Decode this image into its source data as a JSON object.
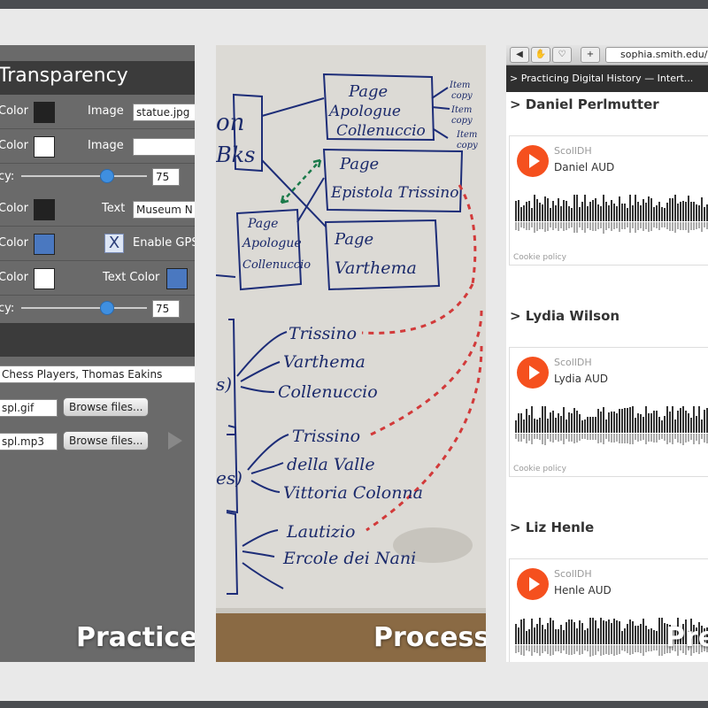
{
  "panel_practice": {
    "title": "Transparency",
    "rows": [
      {
        "label": "Color",
        "right_label": "Image",
        "value": "statue.jpg",
        "swatch": "#222222"
      },
      {
        "label": "Color",
        "right_label": "Image",
        "value": "",
        "swatch": "#ffffff"
      },
      {
        "label": "Color",
        "right_label": "Text",
        "value": "Museum N",
        "swatch": "#222222"
      },
      {
        "label": "Color",
        "right_label": "Enable GPS",
        "swatch": "#4a78c0",
        "checked": "X"
      },
      {
        "label": "Color",
        "right_label": "Text Color",
        "swatch": "#ffffff",
        "swatch2": "#4a78c0"
      }
    ],
    "opacity_label": "cy:",
    "opacity_value_1": "75",
    "opacity_value_2": "75",
    "caption_field": "Chess Players, Thomas Eakins",
    "file1": "spl.gif",
    "file2": "spl.mp3",
    "browse_label": "Browse files...",
    "caption": "Practice"
  },
  "panel_process": {
    "caption": "Process",
    "boxes": [
      "Page",
      "Apologue",
      "Collenuccio",
      "Page",
      "Epistola Trissino",
      "Page",
      "Apologue",
      "Collenuccio",
      "Page",
      "Varthema"
    ],
    "item_notes": [
      "Item",
      "copy",
      "Item",
      "copy",
      "Item",
      "copy"
    ],
    "left_words": [
      "on",
      "Bks"
    ],
    "branches_1": [
      "Trissino",
      "Varthema",
      "Collenuccio"
    ],
    "branches_2": [
      "Trissino",
      "della Valle",
      "Vittoria Colonna"
    ],
    "branches_3": [
      "Lautizio",
      "Ercole dei Nani"
    ],
    "paren_1": "s)",
    "paren_2": "es)"
  },
  "panel_presentation": {
    "url": "sophia.smith.edu/b",
    "tab_title": "> Practicing Digital History — Intert...",
    "caption": "Pre",
    "tracks": [
      {
        "heading": "> Daniel Perlmutter",
        "source": "ScollDH",
        "title": "Daniel AUD",
        "cookie": "Cookie policy"
      },
      {
        "heading": "> Lydia Wilson",
        "source": "ScollDH",
        "title": "Lydia AUD",
        "cookie": "Cookie policy"
      },
      {
        "heading": "> Liz Henle",
        "source": "ScollDH",
        "title": "Henle AUD",
        "cookie": ""
      }
    ],
    "accent": "#f5501e"
  }
}
